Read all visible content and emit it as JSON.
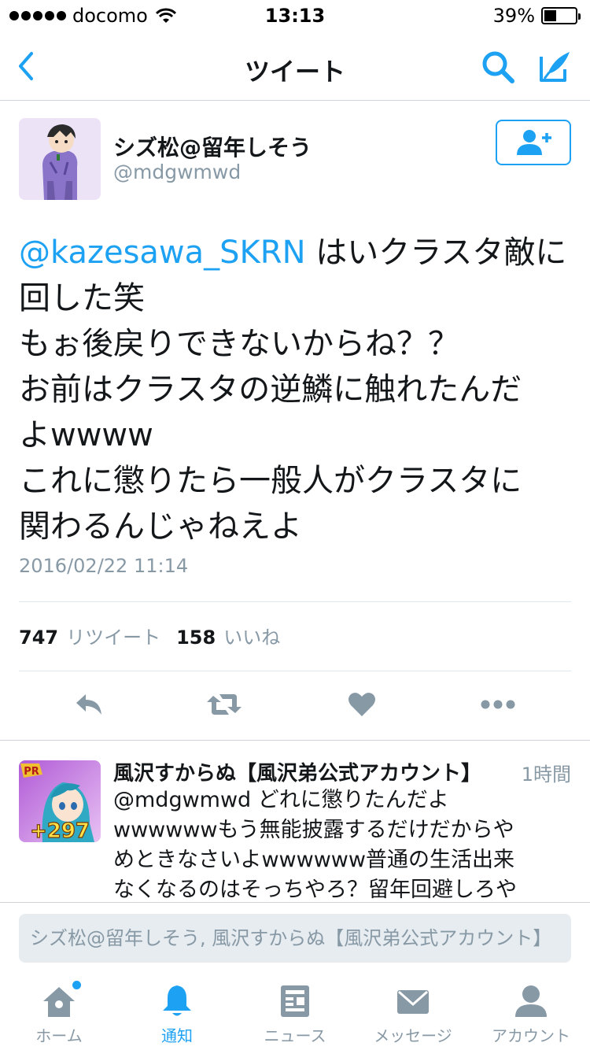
{
  "status_bar": {
    "carrier": "docomo",
    "time": "13:13",
    "battery": "39%",
    "battery_level": 0.39
  },
  "nav": {
    "title": "ツイート",
    "back_icon": "chevron-left-icon",
    "search_icon": "search-icon",
    "compose_icon": "compose-icon"
  },
  "tweet": {
    "author_name": "シズ松@留年しそう",
    "author_handle": "@mdgwmwd",
    "follow_icon": "add-user-icon",
    "mention": "@kazesawa_SKRN",
    "text_lines": [
      " はいクラスタ敵に",
      "回した笑",
      "もぉ後戻りできないからね？？",
      "お前はクラスタの逆鱗に触れたんだ",
      "よwwww",
      "これに懲りたら一般人がクラスタに",
      "関わるんじゃねえよ"
    ],
    "timestamp": "2016/02/22 11:14",
    "retweet_count": "747",
    "retweet_label": "リツイート",
    "like_count": "158",
    "like_label": "いいね"
  },
  "actions": {
    "reply": "reply-icon",
    "retweet": "retweet-icon",
    "like": "heart-icon",
    "more": "more-icon"
  },
  "reply": {
    "name": "風沢すからぬ【風沢弟公式アカウント】",
    "time": "1時間",
    "avatar_badge_top": "PR",
    "avatar_badge": "+297",
    "lines": [
      "@mdgwmwd どれに懲りたんだよ",
      "wwwwwwもう無能披露するだけだからや",
      "めときなさいよwwwwww普通の生活出来",
      "なくなるのはそっちやろ？留年回避しろや"
    ]
  },
  "reply_input": {
    "placeholder": "シズ松@留年しそう, 風沢すからぬ【風沢弟公式アカウント】"
  },
  "tabs": [
    {
      "label": "ホーム",
      "icon": "home-icon"
    },
    {
      "label": "通知",
      "icon": "bell-icon"
    },
    {
      "label": "ニュース",
      "icon": "news-icon"
    },
    {
      "label": "メッセージ",
      "icon": "envelope-icon"
    },
    {
      "label": "アカウント",
      "icon": "person-icon"
    }
  ],
  "colors": {
    "accent": "#1da1f2",
    "muted": "#8899a6",
    "text": "#14171a"
  }
}
